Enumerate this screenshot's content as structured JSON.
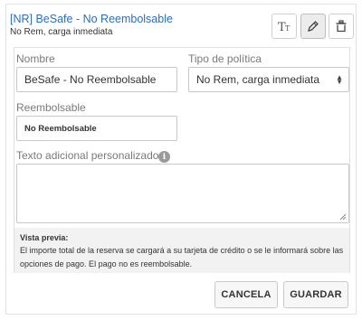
{
  "header": {
    "title": "[NR] BeSafe - No Reembolsable",
    "subtitle": "No Rem, carga inmediata",
    "icons": [
      "text-format-icon",
      "pencil-icon",
      "trash-icon"
    ]
  },
  "form": {
    "nombre_label": "Nombre",
    "nombre_value": "BeSafe - No Reembolsable",
    "tipo_label": "Tipo de política",
    "tipo_value": "No Rem, carga inmediata",
    "reembolsable_label": "Reembolsable",
    "reembolsable_value": "No Reembolsable",
    "texto_label": "Texto adicional personalizado",
    "texto_value": ""
  },
  "preview": {
    "title": "Vista previa:",
    "text": "El importe total de la reserva se cargará a su tarjeta de crédito o se le informará sobre las opciones de pago. El pago no es reembolsable."
  },
  "actions": {
    "cancel_label": "CANCELA",
    "save_label": "GUARDAR"
  },
  "colors": {
    "title": "#2a6ebb",
    "preview_bg": "#f2f2f2"
  }
}
